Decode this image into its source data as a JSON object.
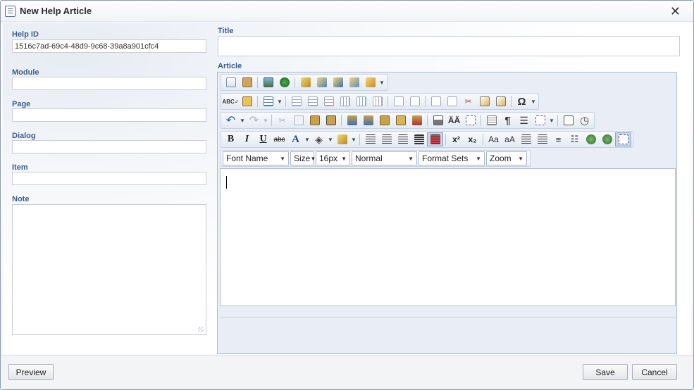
{
  "dialog": {
    "title": "New Help Article",
    "close_glyph": "✕"
  },
  "form": {
    "help_id": {
      "label": "Help ID",
      "value": "1516c7ad-69c4-48d9-9c68-39a8a901cfc4"
    },
    "module": {
      "label": "Module",
      "value": ""
    },
    "page": {
      "label": "Page",
      "value": ""
    },
    "dialog_field": {
      "label": "Dialog",
      "value": ""
    },
    "item": {
      "label": "Item",
      "value": ""
    },
    "note": {
      "label": "Note",
      "value": ""
    },
    "title": {
      "label": "Title",
      "value": ""
    },
    "article": {
      "label": "Article"
    }
  },
  "editor": {
    "toolbar_rows": [
      [
        "document-edit-icon",
        "clear-format-icon",
        "insert-image-icon",
        "image-manager-icon",
        "link-manager-icon",
        "flash-manager-icon",
        "media-manager-icon",
        "document-manager-icon",
        "template-manager-icon"
      ],
      [
        "spellcheck-icon",
        "find-replace-icon",
        "table-icon",
        "insert-row-above-icon",
        "insert-row-below-icon",
        "delete-row-icon",
        "insert-column-left-icon",
        "insert-column-right-icon",
        "delete-column-icon",
        "merge-columns-icon",
        "merge-rows-icon",
        "split-cell-icon",
        "table-properties-icon",
        "cell-properties-icon",
        "symbols-icon"
      ],
      [
        "undo-icon",
        "redo-icon",
        "cut-icon",
        "copy-icon",
        "paste-icon",
        "paste-from-word-icon",
        "paste-plain-text-icon",
        "paste-as-html-icon",
        "print-icon",
        "find-icon",
        "select-all-icon",
        "format-stripper-icon",
        "paragraph-icon",
        "horizontal-rule-icon",
        "insert-snippet-icon",
        "module-manager-icon",
        "track-changes-icon"
      ],
      [
        "bold-icon",
        "italic-icon",
        "underline-icon",
        "strikethrough-icon",
        "fore-color-icon",
        "back-color-icon",
        "format-painter-icon",
        "align-left-icon",
        "align-center-icon",
        "align-right-icon",
        "justify-icon",
        "remove-alignment-icon",
        "superscript-icon",
        "subscript-icon",
        "convert-to-lower-icon",
        "convert-to-upper-icon",
        "indent-icon",
        "outdent-icon",
        "ordered-list-icon",
        "unordered-list-icon",
        "hyperlink-icon",
        "unlink-icon",
        "toggle-border-icon"
      ]
    ],
    "dropdowns": [
      {
        "name": "font-name-select",
        "label": "Font Name"
      },
      {
        "name": "font-size-select",
        "label": "Size"
      },
      {
        "name": "real-font-size-select",
        "label": "16px"
      },
      {
        "name": "paragraph-style-select",
        "label": "Normal"
      },
      {
        "name": "format-sets-select",
        "label": "Format Sets"
      },
      {
        "name": "zoom-select",
        "label": "Zoom"
      }
    ],
    "symbols_glyph": "Ω",
    "bold_glyph": "B",
    "italic_glyph": "I",
    "underline_glyph": "U",
    "strike_glyph": "abc",
    "forecolor_glyph": "A",
    "super_glyph": "x²",
    "sub_glyph": "x₂",
    "undo_glyph": "↶",
    "redo_glyph": "↷",
    "paragraph_glyph": "¶",
    "content": ""
  },
  "footer": {
    "preview_label": "Preview",
    "save_label": "Save",
    "cancel_label": "Cancel"
  },
  "colors": {
    "label_blue": "#3b5d8c",
    "toolbar_bg": "#e4eaf3"
  }
}
